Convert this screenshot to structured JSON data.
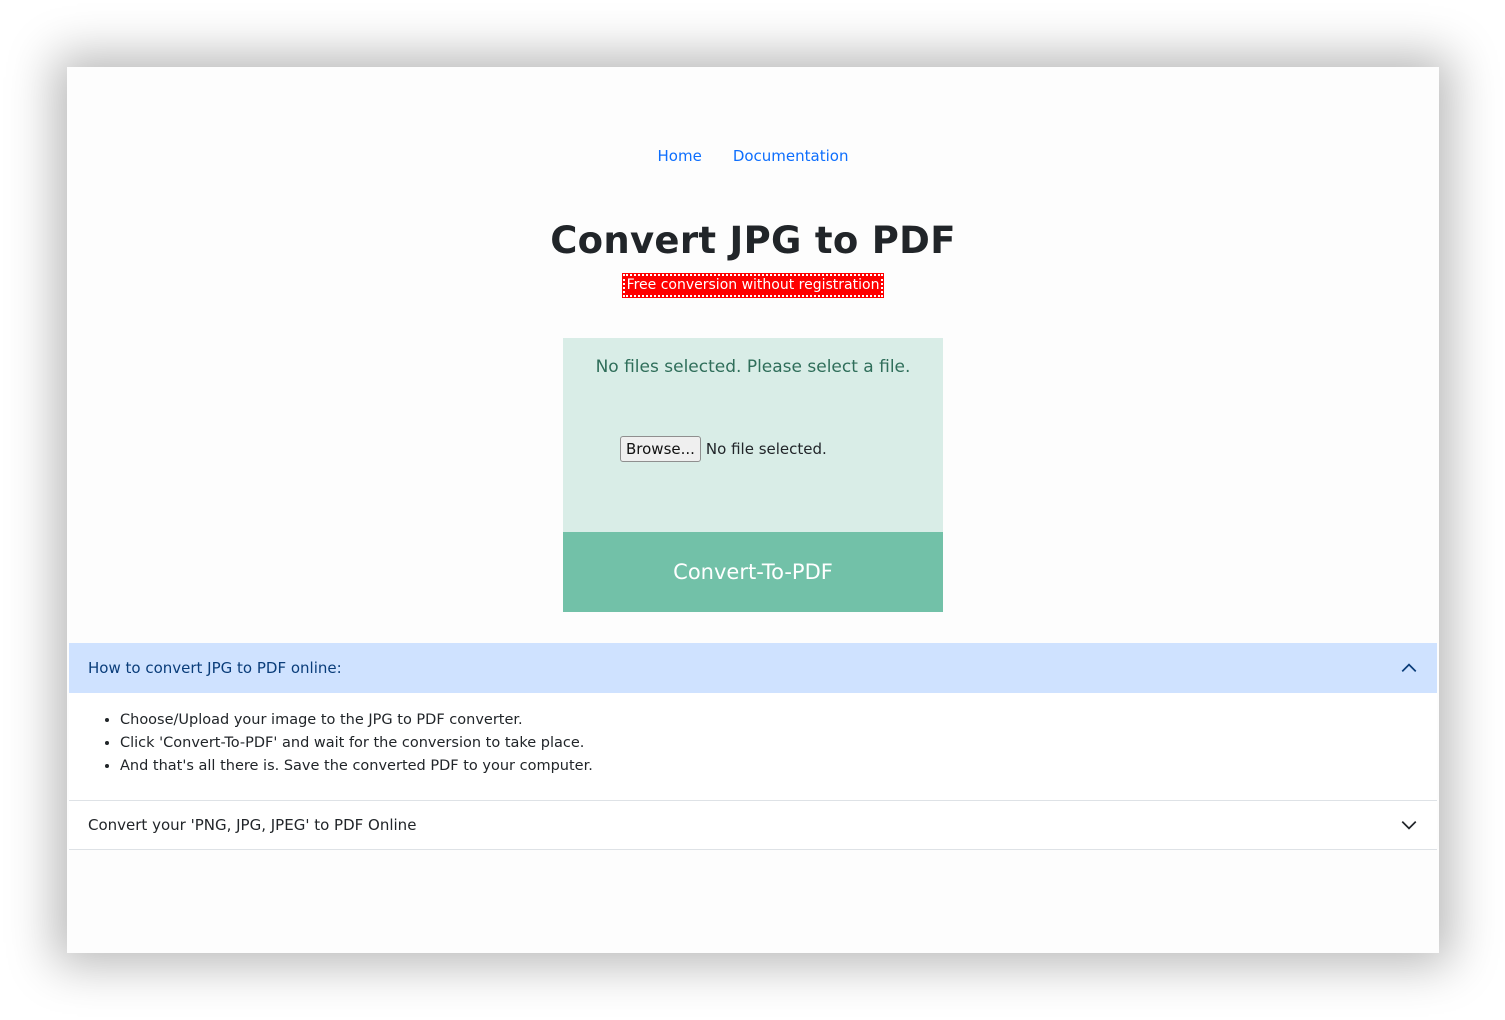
{
  "nav": {
    "home": "Home",
    "documentation": "Documentation"
  },
  "page": {
    "title": "Convert JPG to PDF",
    "subtitle": "Free conversion without registration"
  },
  "upload": {
    "message": "No files selected. Please select a file.",
    "browse_label": "Browse...",
    "file_status": "No file selected.",
    "convert_label": "Convert-To-PDF"
  },
  "accordion": {
    "items": [
      {
        "title": "How to convert JPG to PDF online:",
        "expanded": true,
        "steps": [
          "Choose/Upload your image to the JPG to PDF converter.",
          "Click 'Convert-To-PDF' and wait for the conversion to take place.",
          "And that's all there is. Save the converted PDF to your computer."
        ]
      },
      {
        "title": "Convert your 'PNG, JPG, JPEG' to PDF Online",
        "expanded": false
      }
    ]
  },
  "icons": {
    "expanded": "chevron-up-icon",
    "collapsed": "chevron-down-icon"
  },
  "colors": {
    "link": "#0d6efd",
    "badge": "#ff0000",
    "upload_bg": "#d9ede7",
    "convert_button": "#72c1a8",
    "accordion_open": "#cfe2ff"
  }
}
